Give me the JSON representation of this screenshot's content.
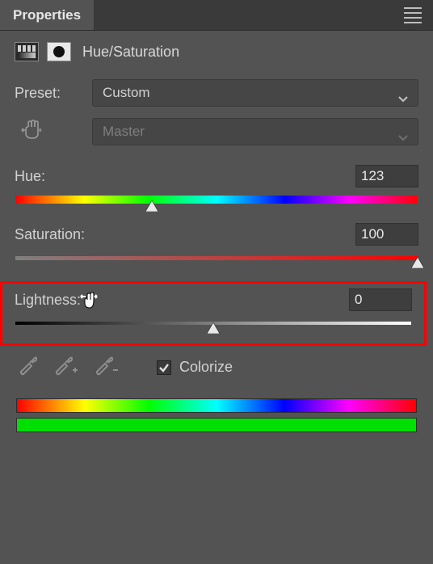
{
  "panel": {
    "title": "Properties"
  },
  "adjustment": {
    "name": "Hue/Saturation"
  },
  "preset": {
    "label": "Preset:",
    "value": "Custom"
  },
  "channel": {
    "value": "Master"
  },
  "sliders": {
    "hue": {
      "label": "Hue:",
      "value": "123",
      "pos_pct": 34
    },
    "saturation": {
      "label": "Saturation:",
      "value": "100",
      "pos_pct": 100
    },
    "lightness": {
      "label": "Lightness:",
      "value": "0",
      "pos_pct": 50
    }
  },
  "colorize": {
    "label": "Colorize",
    "checked": true
  },
  "icons": {
    "hand": "hand-scrubby-icon",
    "eyedropper": "eyedropper-icon",
    "eyedropper_plus": "eyedropper-plus-icon",
    "eyedropper_minus": "eyedropper-minus-icon"
  },
  "chart_data": {
    "type": "table",
    "title": "Hue/Saturation adjustment sliders",
    "rows": [
      {
        "parameter": "Hue",
        "value": 123,
        "range": [
          -180,
          180
        ]
      },
      {
        "parameter": "Saturation",
        "value": 100,
        "range": [
          -100,
          100
        ]
      },
      {
        "parameter": "Lightness",
        "value": 0,
        "range": [
          -100,
          100
        ]
      }
    ]
  }
}
